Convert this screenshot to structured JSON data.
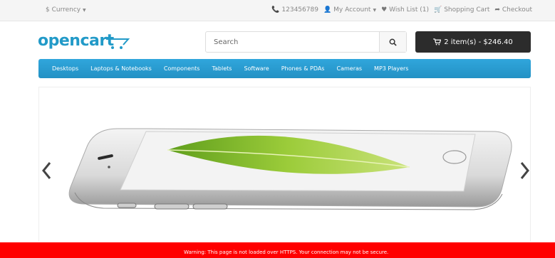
{
  "topbar": {
    "currency": "$ Currency",
    "phone": "123456789",
    "my_account": "My Account",
    "wish_list": "Wish List (1)",
    "shopping_cart": "Shopping Cart",
    "checkout": "Checkout"
  },
  "header": {
    "logo": "opencart",
    "search_placeholder": "Search",
    "cart_button": "2 item(s) - $246.40"
  },
  "menu": {
    "items": [
      "Desktops",
      "Laptops & Notebooks",
      "Components",
      "Tablets",
      "Software",
      "Phones & PDAs",
      "Cameras",
      "MP3 Players"
    ]
  },
  "warning": {
    "text": "Warning: This page is not loaded over HTTPS. Your connection may not be secure."
  },
  "colors": {
    "brand": "#229ac8",
    "menu": "#2a9ed3",
    "cart_button": "#2c2c2c",
    "warning": "#ff0000"
  }
}
